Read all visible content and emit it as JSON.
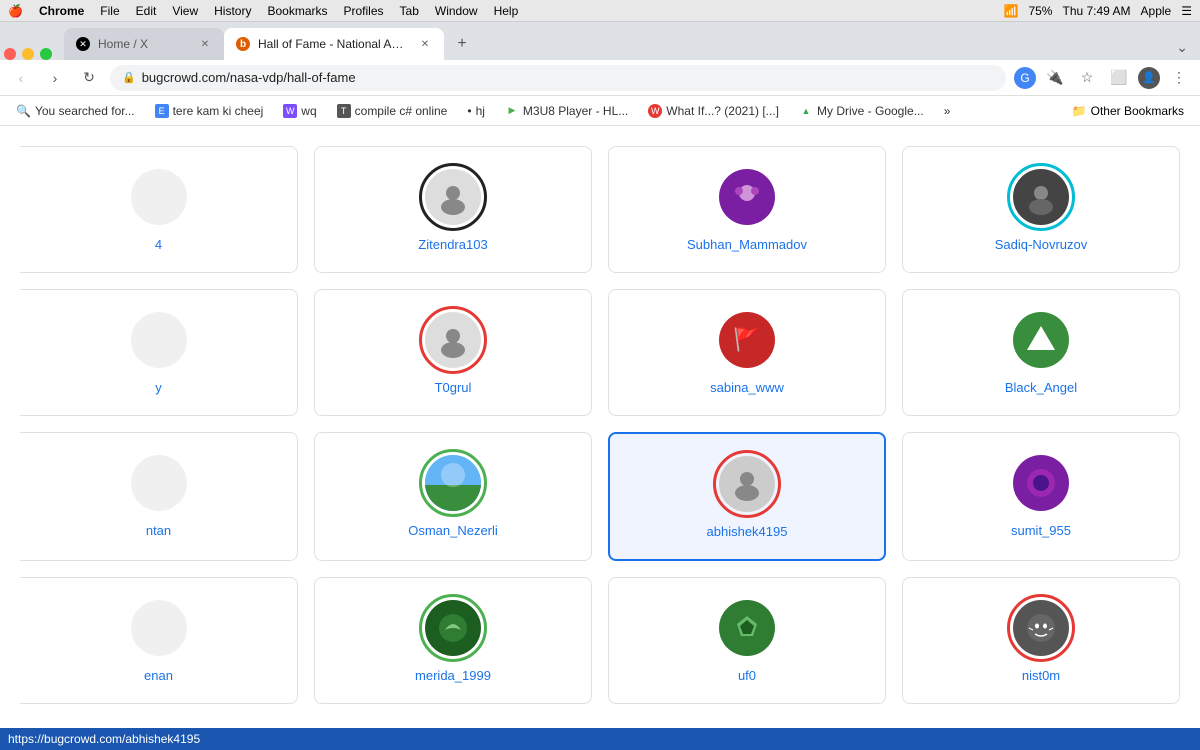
{
  "menubar": {
    "apple": "🍎",
    "chrome": "Chrome",
    "file": "File",
    "edit": "Edit",
    "view": "View",
    "history": "History",
    "bookmarks": "Bookmarks",
    "profiles": "Profiles",
    "tab": "Tab",
    "window": "Window",
    "help": "Help",
    "right": {
      "time": "Thu 7:49 AM",
      "battery": "75%",
      "apple_right": "Apple"
    }
  },
  "tabs": [
    {
      "id": "tab1",
      "favicon_color": "#000",
      "favicon_text": "✕",
      "title": "Home / X",
      "active": false
    },
    {
      "id": "tab2",
      "favicon_color": "#e05c00",
      "favicon_text": "b",
      "title": "Hall of Fame - National Aerona...",
      "active": true
    }
  ],
  "address_bar": {
    "url": "bugcrowd.com/nasa-vdp/hall-of-fame",
    "lock_icon": "🔒"
  },
  "bookmarks": [
    {
      "text": "You searched for...",
      "favicon": "🔍"
    },
    {
      "text": "tere kam ki cheej",
      "favicon": "E",
      "favicon_color": "#4285f4"
    },
    {
      "text": "wq",
      "favicon": "W",
      "favicon_color": "#7c4dff"
    },
    {
      "text": "compile c# online",
      "favicon": "T",
      "favicon_color": "#555"
    },
    {
      "text": "hj",
      "favicon": "•"
    },
    {
      "text": "M3U8 Player - HL...",
      "favicon": "▶",
      "favicon_color": "#4caf50"
    },
    {
      "text": "What If...? (2021) [...]",
      "favicon": "W",
      "favicon_color": "#e53935"
    },
    {
      "text": "My Drive - Google...",
      "favicon": "▲",
      "favicon_color": "#34a853"
    },
    {
      "text": "»",
      "favicon": ""
    }
  ],
  "other_bookmarks": "Other Bookmarks",
  "hof_users": [
    {
      "username": "",
      "avatar_bg": "#f0f0f0",
      "avatar_color": "#999",
      "ring_color": "transparent",
      "partial": true,
      "row": 0,
      "col": 0
    },
    {
      "username": "Zitendra103",
      "avatar_bg": "#e8e8e8",
      "avatar_emoji": "👤",
      "ring_color": "#222",
      "partial": false,
      "row": 0,
      "col": 1
    },
    {
      "username": "Subhan_Mammadov",
      "avatar_bg": "#7b1fa2",
      "avatar_emoji": "👤",
      "ring_color": "transparent",
      "partial": false,
      "row": 0,
      "col": 2
    },
    {
      "username": "Sadiq-Novruzov",
      "avatar_bg": "#555",
      "avatar_emoji": "👤",
      "ring_color": "#00bcd4",
      "partial": false,
      "row": 0,
      "col": 3
    },
    {
      "username": "",
      "avatar_bg": "#f0f0f0",
      "avatar_color": "#bbb",
      "ring_color": "transparent",
      "partial": true,
      "row": 1,
      "col": 0
    },
    {
      "username": "T0grul",
      "avatar_bg": "#ddd",
      "avatar_emoji": "👤",
      "ring_color": "#e53935",
      "partial": false,
      "row": 1,
      "col": 1
    },
    {
      "username": "sabina_www",
      "avatar_bg": "#c62828",
      "avatar_emoji": "🚩",
      "ring_color": "transparent",
      "partial": false,
      "row": 1,
      "col": 2
    },
    {
      "username": "Black_Angel",
      "avatar_bg": "#388e3c",
      "avatar_emoji": "◆",
      "ring_color": "transparent",
      "partial": false,
      "row": 1,
      "col": 3
    },
    {
      "username": "",
      "avatar_bg": "#f0f0f0",
      "ring_color": "transparent",
      "partial": true,
      "row": 2,
      "col": 0
    },
    {
      "username": "Osman_Nezerli",
      "avatar_bg": "#4fc3f7",
      "avatar_emoji": "🌄",
      "ring_color": "#4caf50",
      "partial": false,
      "row": 2,
      "col": 1
    },
    {
      "username": "abhishek4195",
      "avatar_bg": "#ddd",
      "avatar_emoji": "👤",
      "ring_color": "#e53935",
      "highlighted": true,
      "partial": false,
      "row": 2,
      "col": 2
    },
    {
      "username": "sumit_955",
      "avatar_bg": "#7b1fa2",
      "avatar_emoji": "◉",
      "ring_color": "transparent",
      "partial": false,
      "row": 2,
      "col": 3
    },
    {
      "username": "",
      "avatar_bg": "#f0f0f0",
      "ring_color": "transparent",
      "partial": true,
      "row": 3,
      "col": 0
    },
    {
      "username": "merida_1999",
      "avatar_bg": "#1b5e20",
      "avatar_emoji": "🌿",
      "ring_color": "#4caf50",
      "partial": false,
      "row": 3,
      "col": 1
    },
    {
      "username": "uf0",
      "avatar_bg": "#2e7d32",
      "avatar_emoji": "💎",
      "ring_color": "transparent",
      "partial": false,
      "row": 3,
      "col": 2
    },
    {
      "username": "nist0m",
      "avatar_bg": "#555",
      "avatar_emoji": "🐱",
      "ring_color": "#e53935",
      "partial": false,
      "row": 3,
      "col": 3
    }
  ],
  "status_bar": {
    "url": "https://bugcrowd.com/abhishek4195"
  }
}
